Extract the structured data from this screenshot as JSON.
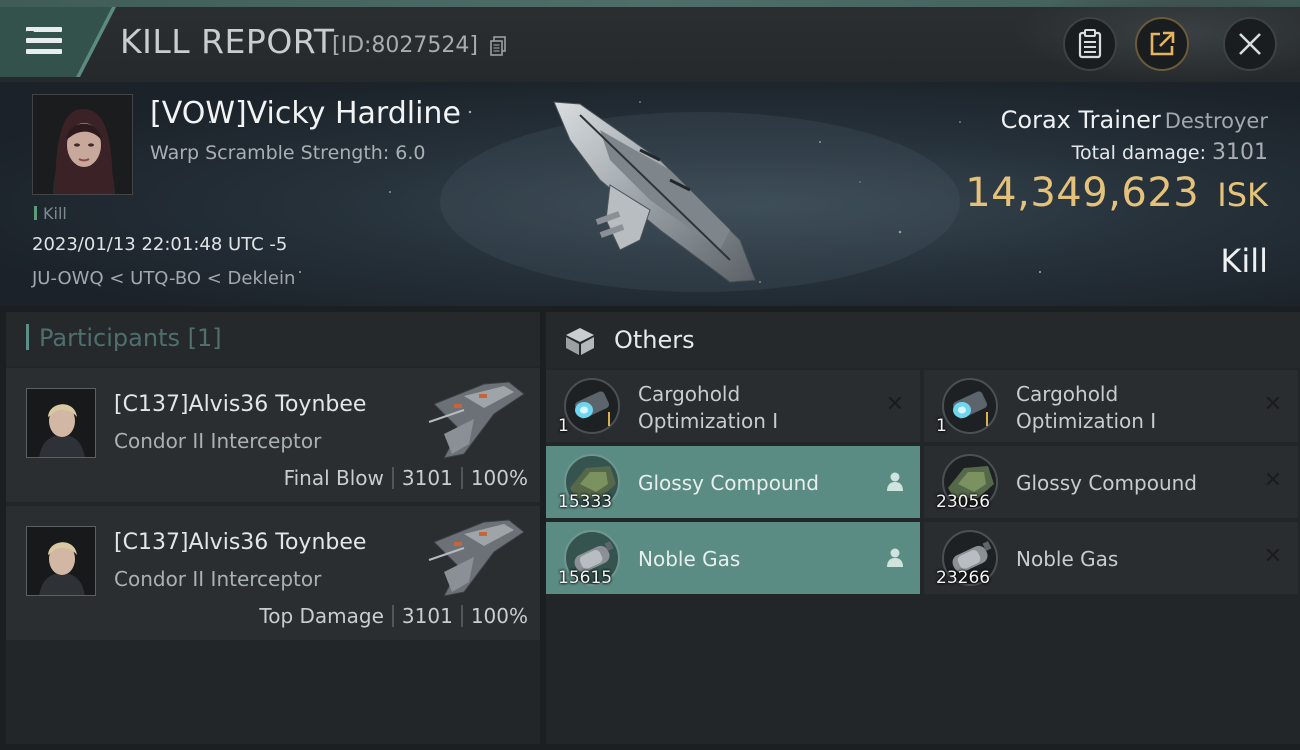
{
  "header": {
    "title": "KILL REPORT",
    "report_id": "[ID:8027524]"
  },
  "victim": {
    "name": "[VOW]Vicky Hardline",
    "warp_scramble": "Warp Scramble Strength: 6.0",
    "tag": "Kill",
    "time": "2023/01/13 22:01:48 UTC -5",
    "location": "JU-OWQ < UTQ-BO < Deklein",
    "ship_name": "Corax Trainer",
    "ship_class": "Destroyer",
    "total_damage_label": "Total damage:",
    "total_damage": "3101",
    "isk_value": "14,349,623",
    "isk_unit": "ISK",
    "result": "Kill"
  },
  "participants": {
    "title": "Participants [1]",
    "items": [
      {
        "name": "[C137]Alvis36 Toynbee",
        "ship": "Condor II Interceptor",
        "role": "Final Blow",
        "damage": "3101",
        "percent": "100%"
      },
      {
        "name": "[C137]Alvis36 Toynbee",
        "ship": "Condor II Interceptor",
        "role": "Top Damage",
        "damage": "3101",
        "percent": "100%"
      }
    ]
  },
  "others": {
    "title": "Others",
    "items": [
      {
        "line1": "Cargohold",
        "line2": "Optimization I",
        "qty": "1",
        "status": "destroyed",
        "icon": "cargohold-rig-icon"
      },
      {
        "line1": "Cargohold",
        "line2": "Optimization I",
        "qty": "1",
        "status": "destroyed",
        "icon": "cargohold-rig-icon"
      },
      {
        "line1": "Glossy Compound",
        "line2": "",
        "qty": "15333",
        "status": "dropped",
        "icon": "compound-icon"
      },
      {
        "line1": "Glossy Compound",
        "line2": "",
        "qty": "23056",
        "status": "destroyed",
        "icon": "compound-icon"
      },
      {
        "line1": "Noble Gas",
        "line2": "",
        "qty": "15615",
        "status": "dropped",
        "icon": "gas-canister-icon"
      },
      {
        "line1": "Noble Gas",
        "line2": "",
        "qty": "23266",
        "status": "destroyed",
        "icon": "gas-canister-icon"
      }
    ]
  },
  "colors": {
    "accent": "#5b8c84",
    "isk": "#e5c27a",
    "dropped": "#5b8c84"
  }
}
